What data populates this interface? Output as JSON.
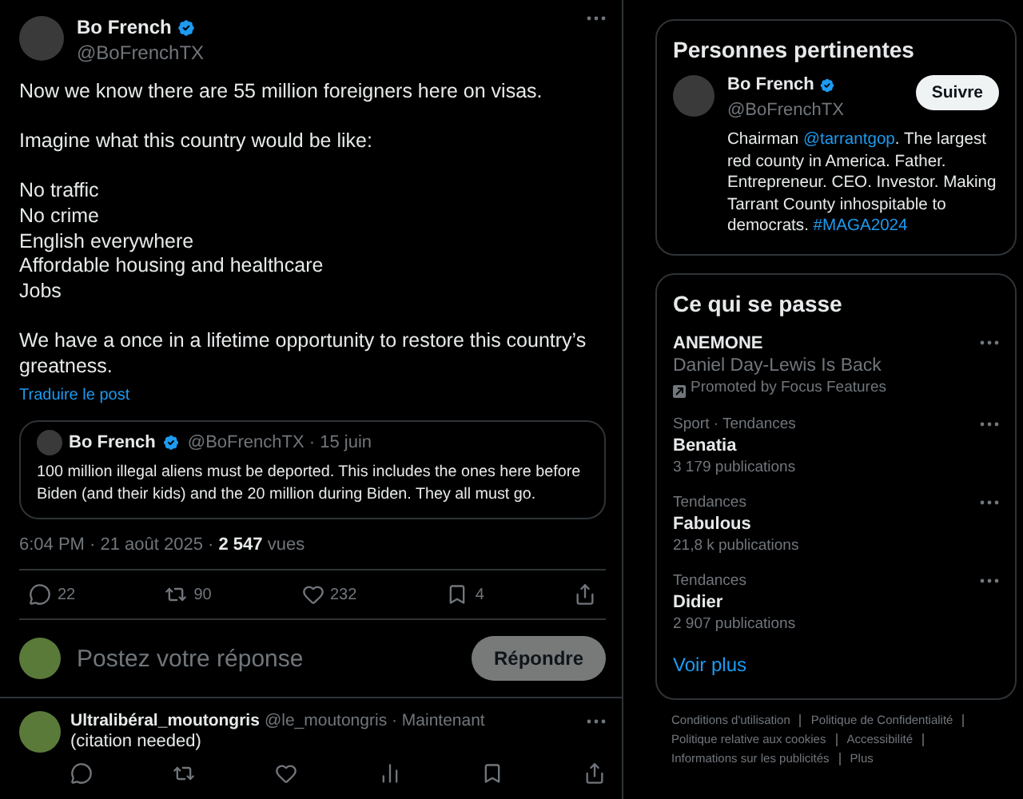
{
  "post": {
    "author": "Bo French",
    "handle": "@BoFrenchTX",
    "verified": true,
    "text": "Now we know there are 55 million foreigners here on visas.\n\nImagine what this country would be like:\n\nNo traffic\nNo crime\nEnglish everywhere\nAffordable housing and healthcare\nJobs\n\nWe have a once in a lifetime opportunity to restore this country’s greatness.",
    "translate": "Traduire le post",
    "quote": {
      "author": "Bo French",
      "verified": true,
      "handle": "@BoFrenchTX · 15 juin",
      "text": "100 million illegal aliens must be deported. This includes the ones here before Biden (and their kids) and the 20 million during Biden. They all must go."
    },
    "meta": "6:04 PM · 21 août 2025 · **2 547** vues",
    "actions": [
      {
        "kind": "reply",
        "count": "22"
      },
      {
        "kind": "repost",
        "count": "90"
      },
      {
        "kind": "like",
        "count": "232"
      },
      {
        "kind": "bookmark",
        "count": "4"
      },
      {
        "kind": "share"
      }
    ]
  },
  "composer": {
    "placeholder": "Postez votre réponse",
    "button": "Répondre"
  },
  "replies": [
    {
      "author": "Ultralibéral_moutongris",
      "handle": "@le_moutongris · Maintenant",
      "text": "(citation needed)",
      "actions": [
        {
          "kind": "reply"
        },
        {
          "kind": "repost"
        },
        {
          "kind": "like"
        },
        {
          "kind": "views"
        },
        {
          "kind": "bookmark"
        },
        {
          "kind": "share"
        }
      ]
    }
  ],
  "relevant": {
    "title": "Personnes pertinentes",
    "person": {
      "name": "Bo French",
      "handle": "@BoFrenchTX",
      "verified": true,
      "follow": "Suivre",
      "bio": [
        {
          "kind": "text",
          "text": "Chairman "
        },
        {
          "kind": "link",
          "text": "@tarrantgop"
        },
        {
          "kind": "text",
          "text": ". The largest red county in America. Father. Entrepreneur. CEO. Investor. Making Tarrant County inhospitable to democrats. "
        },
        {
          "kind": "link",
          "text": "#MAGA2024"
        }
      ]
    }
  },
  "trends": {
    "title": "Ce qui se passe",
    "items": [
      {
        "kind": "promoted",
        "name": "ANEMONE",
        "subtitle": "Daniel Day-Lewis Is Back",
        "note": "Promoted by Focus Features"
      },
      {
        "kind": "trend",
        "category": "Sport · Tendances",
        "name": "Benatia",
        "note": "3 179 publications"
      },
      {
        "kind": "trend",
        "category": "Tendances",
        "name": "Fabulous",
        "note": "21,8 k publications"
      },
      {
        "kind": "trend",
        "category": "Tendances",
        "name": "Didier",
        "note": "2 907 publications"
      }
    ],
    "more": "Voir plus"
  },
  "footer": [
    "Conditions d'utilisation",
    "Politique de Confidentialité",
    "Politique relative aux cookies",
    "Accessibilité",
    "Informations sur les publicités",
    "Plus"
  ]
}
